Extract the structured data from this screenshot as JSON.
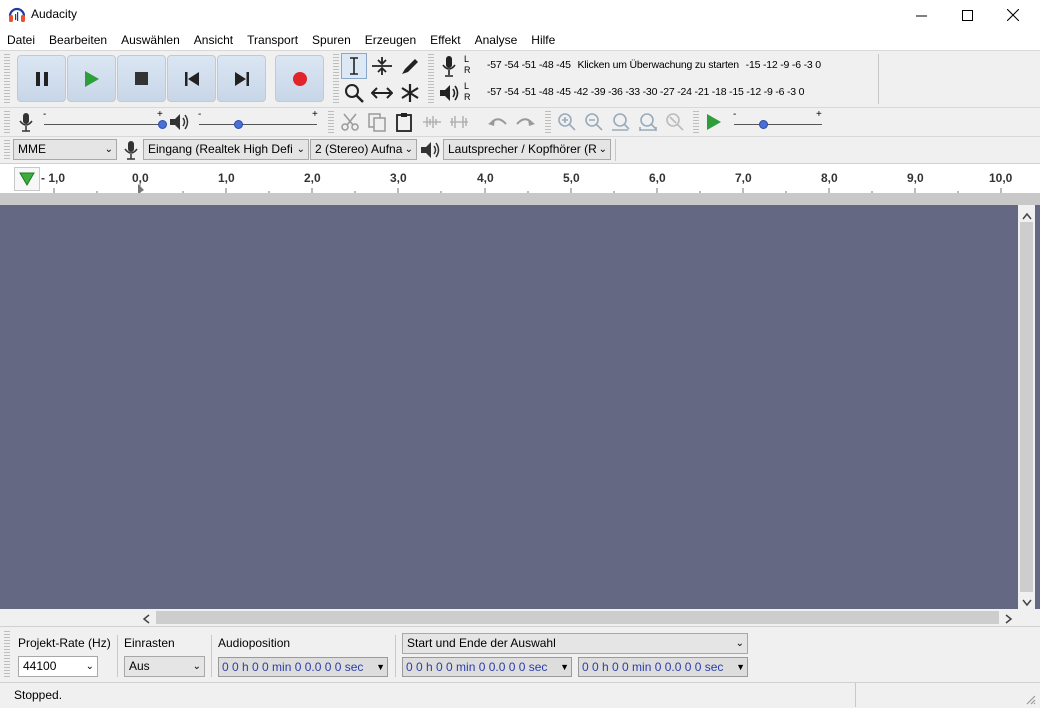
{
  "window": {
    "title": "Audacity"
  },
  "menu": [
    "Datei",
    "Bearbeiten",
    "Auswählen",
    "Ansicht",
    "Transport",
    "Spuren",
    "Erzeugen",
    "Effekt",
    "Analyse",
    "Hilfe"
  ],
  "meters": {
    "channels": [
      "L",
      "R"
    ],
    "record_scale": "-57 -54 -51 -48 -45",
    "record_hint": "Klicken um Überwachung zu starten",
    "record_scale_end": "-15 -12  -9  -6  -3  0",
    "play_scale": "-57 -54 -51 -48 -45 -42 -39 -36 -33 -30 -27 -24 -21 -18 -15 -12  -9  -6  -3  0"
  },
  "sliders": {
    "minus": "-",
    "plus": "+"
  },
  "device": {
    "host": "MME",
    "input": "Eingang (Realtek High Defi",
    "channels": "2 (Stereo) Aufna",
    "output": "Lautsprecher / Kopfhörer (R"
  },
  "ruler": {
    "ticks": [
      "- 1,0",
      "0,0",
      "1,0",
      "2,0",
      "3,0",
      "4,0",
      "5,0",
      "6,0",
      "7,0",
      "8,0",
      "9,0",
      "10,0"
    ]
  },
  "selection_bar": {
    "rate_label": "Projekt-Rate (Hz)",
    "rate_value": "44100",
    "snap_label": "Einrasten",
    "snap_value": "Aus",
    "position_label": "Audioposition",
    "selection_mode": "Start und Ende der Auswahl",
    "time_value": "0 0 h 0 0 min 0 0.0 0 0 sec"
  },
  "status": {
    "text": "Stopped."
  },
  "colors": {
    "track_bg": "#656883",
    "play_green": "#2e9e3a",
    "record_red": "#e0242a",
    "accent_blue": "#4a6fd6"
  }
}
